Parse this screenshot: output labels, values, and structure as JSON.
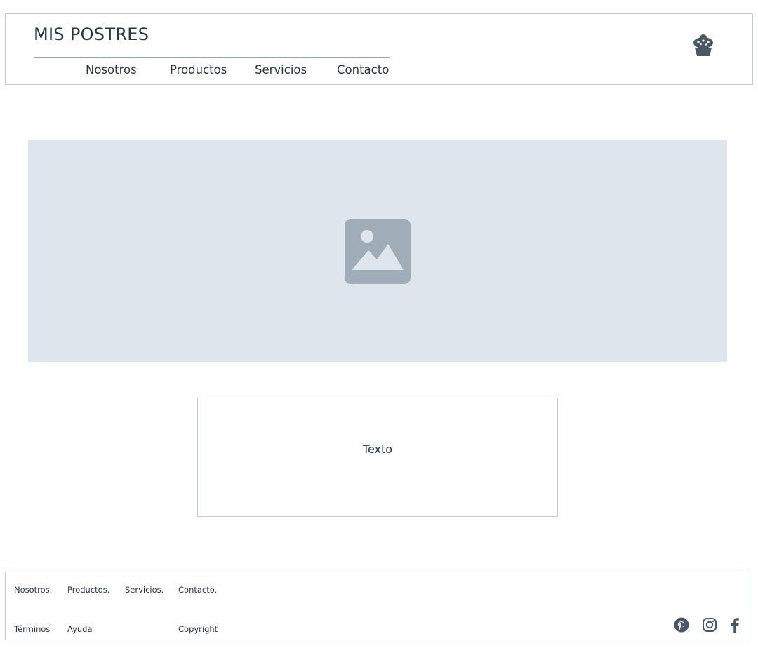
{
  "header": {
    "brand": "MIS POSTRES",
    "nav": [
      {
        "label": "Nosotros"
      },
      {
        "label": "Productos"
      },
      {
        "label": "Servicios"
      },
      {
        "label": "Contacto"
      }
    ],
    "cart_icon": "cupcake-icon"
  },
  "hero": {
    "icon": "image-placeholder-icon",
    "bg_color": "#dfe5ec",
    "icon_color": "#a0adb9"
  },
  "content": {
    "text": "Texto"
  },
  "footer": {
    "row1": [
      "Nosotros.",
      "Productos.",
      "Servicios.",
      "Contacto."
    ],
    "row2": [
      "Términos",
      "Ayuda",
      "Copyright"
    ],
    "social_icons": [
      "pinterest-icon",
      "instagram-icon",
      "facebook-icon"
    ]
  },
  "colors": {
    "text": "#2a3440",
    "border": "#c3ccd6",
    "icon_dark": "#4a5866"
  }
}
